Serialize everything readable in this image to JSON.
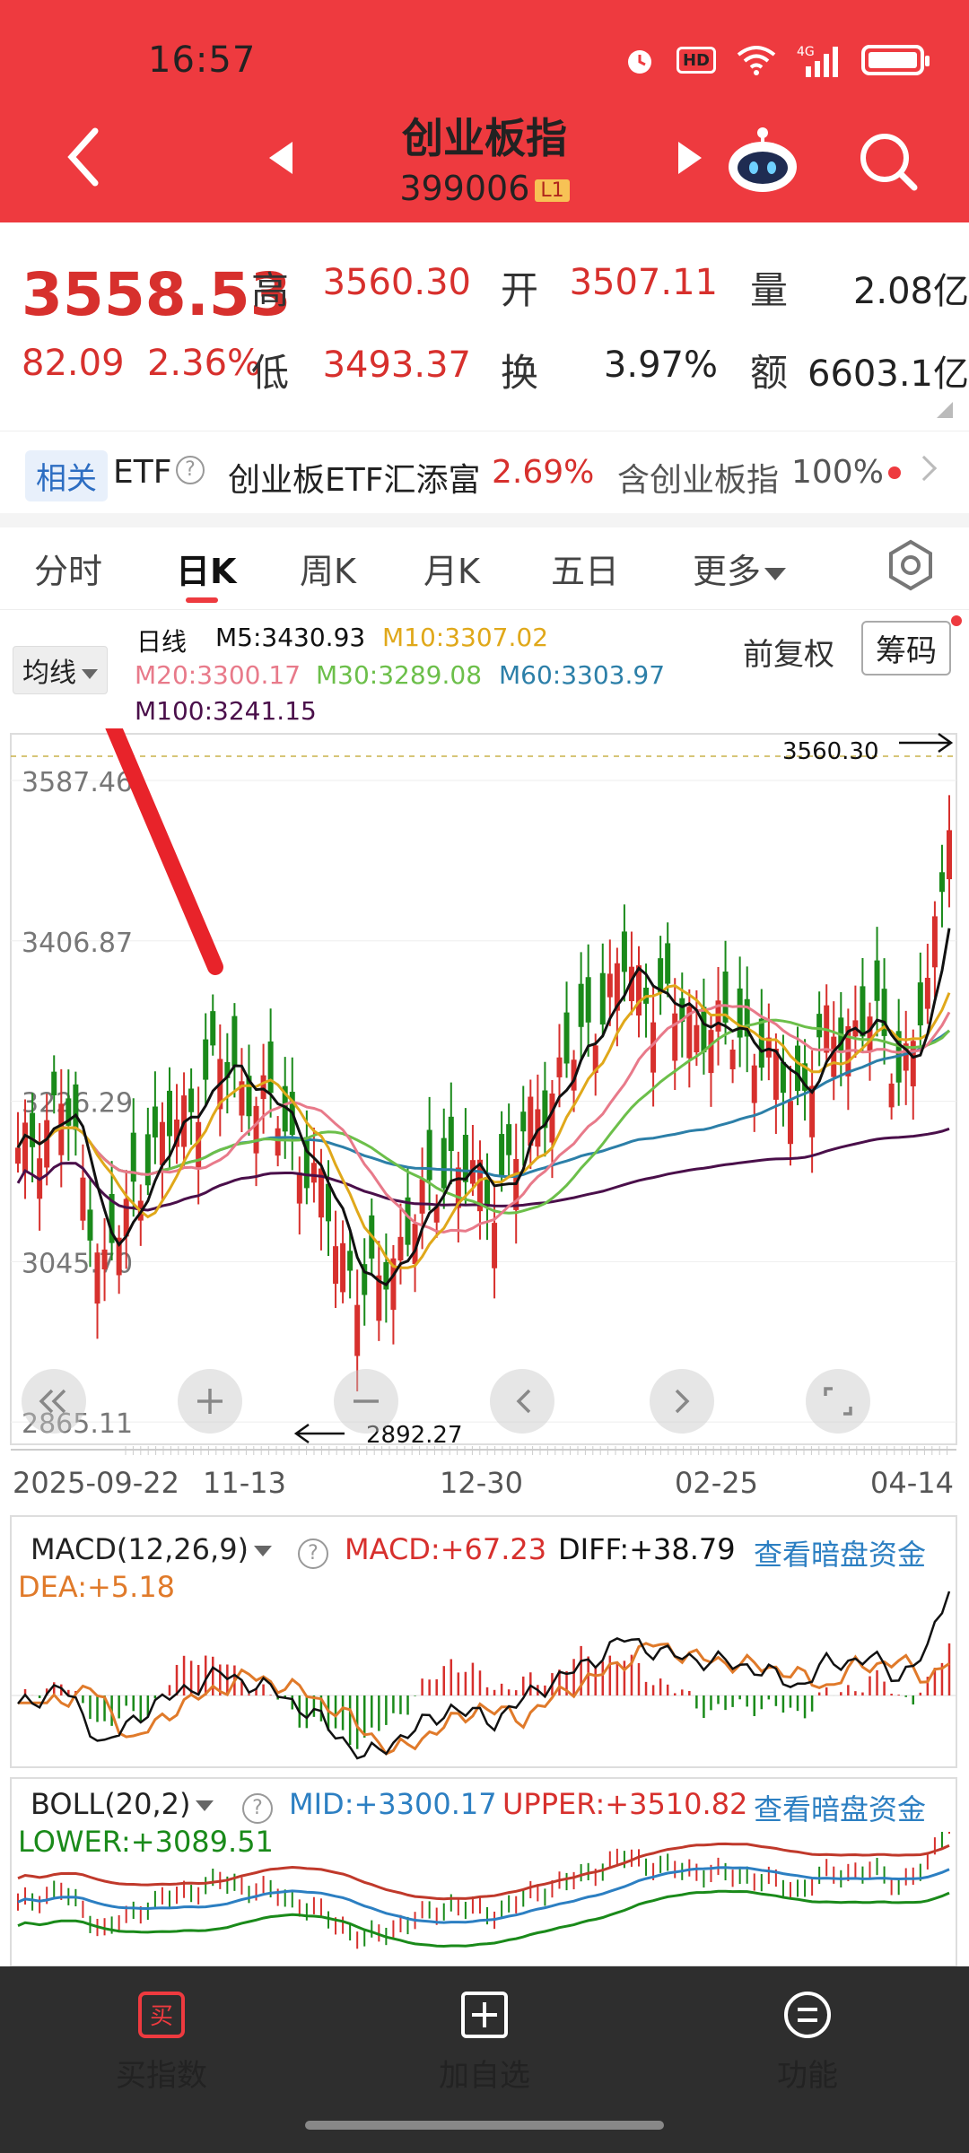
{
  "status": {
    "time": "16:57",
    "hd": "HD",
    "net": "4G"
  },
  "header": {
    "title": "创业板指",
    "code": "399006",
    "level": "L1"
  },
  "quote": {
    "price": "3558.53",
    "change": "82.09",
    "change_pct": "2.36%",
    "high_label": "高",
    "high": "3560.30",
    "open_label": "开",
    "open": "3507.11",
    "vol_label": "量",
    "vol": "2.08亿",
    "low_label": "低",
    "low": "3493.37",
    "turn_label": "换",
    "turn": "3.97%",
    "amt_label": "额",
    "amt": "6603.1亿"
  },
  "etf": {
    "tag": "相关",
    "etf": "ETF",
    "name": "创业板ETF汇添富",
    "pct": "2.69%",
    "contains": "含创业板指",
    "weight": "100%"
  },
  "tabs": [
    "分时",
    "日K",
    "周K",
    "月K",
    "五日",
    "更多"
  ],
  "ma": {
    "selector": "均线",
    "period": "日线",
    "m5": "M5:3430.93",
    "m10": "M10:3307.02",
    "m20": "M20:3300.17",
    "m30": "M30:3289.08",
    "m60": "M60:3303.97",
    "m100": "M100:3241.15",
    "fuquan": "前复权",
    "chouma": "筹码"
  },
  "kline": {
    "y_ticks": [
      "3587.46",
      "3406.87",
      "3226.29",
      "3045.70",
      "2865.11"
    ],
    "y_values": [
      3587.46,
      3406.87,
      3226.29,
      3045.7,
      2865.11
    ],
    "max_mark": "3560.30",
    "min_mark": "2892.27",
    "x_ticks": [
      "2025-09-22",
      "11-13",
      "12-30",
      "02-25",
      "04-14"
    ]
  },
  "macd": {
    "selector": "MACD(12,26,9)",
    "macd": "MACD:+67.23",
    "diff": "DIFF:+38.79",
    "dea": "DEA:+5.18",
    "link": "查看暗盘资金"
  },
  "boll": {
    "selector": "BOLL(20,2)",
    "mid": "MID:+3300.17",
    "upper": "UPPER:+3510.82",
    "lower": "LOWER:+3089.51",
    "link": "查看暗盘资金"
  },
  "bottom": {
    "buy": "买指数",
    "buy_icon": "买",
    "add": "加自选",
    "func": "功能"
  },
  "colors": {
    "header": "#ee3a3f",
    "up": "#d7302d",
    "down": "#1a8a1a",
    "m5": "#111111",
    "m10": "#e0a81a",
    "m20": "#e87a8a",
    "m30": "#6cbf4a",
    "m60": "#2c7fa8",
    "m100": "#4a0f4a"
  }
}
